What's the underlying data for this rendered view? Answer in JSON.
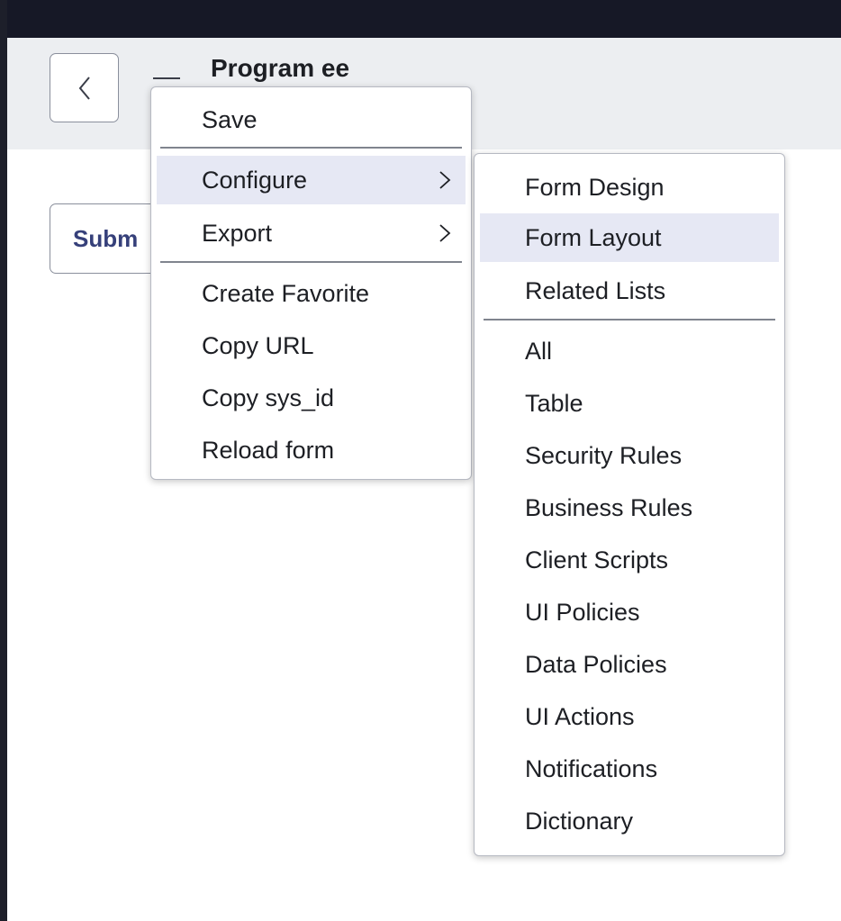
{
  "header": {
    "title": "Program ee",
    "back_icon": "chevron-left-icon"
  },
  "form": {
    "submit_label": "Subm"
  },
  "context_menu": {
    "items": [
      {
        "label": "Save"
      },
      {
        "label": "Configure",
        "has_submenu": true,
        "highlighted": true
      },
      {
        "label": "Export",
        "has_submenu": true
      },
      {
        "label": "Create Favorite"
      },
      {
        "label": "Copy URL"
      },
      {
        "label": "Copy sys_id"
      },
      {
        "label": "Reload form"
      }
    ]
  },
  "configure_submenu": {
    "items": [
      {
        "label": "Form Design"
      },
      {
        "label": "Form Layout",
        "highlighted": true
      },
      {
        "label": "Related Lists"
      },
      {
        "label": "All"
      },
      {
        "label": "Table"
      },
      {
        "label": "Security Rules"
      },
      {
        "label": "Business Rules"
      },
      {
        "label": "Client Scripts"
      },
      {
        "label": "UI Policies"
      },
      {
        "label": "Data Policies"
      },
      {
        "label": "UI Actions"
      },
      {
        "label": "Notifications"
      },
      {
        "label": "Dictionary"
      }
    ]
  },
  "colors": {
    "top_bar": "#161826",
    "header_bg": "#eceef1",
    "highlight": "#e6e8f4",
    "submit_text": "#36407a"
  }
}
